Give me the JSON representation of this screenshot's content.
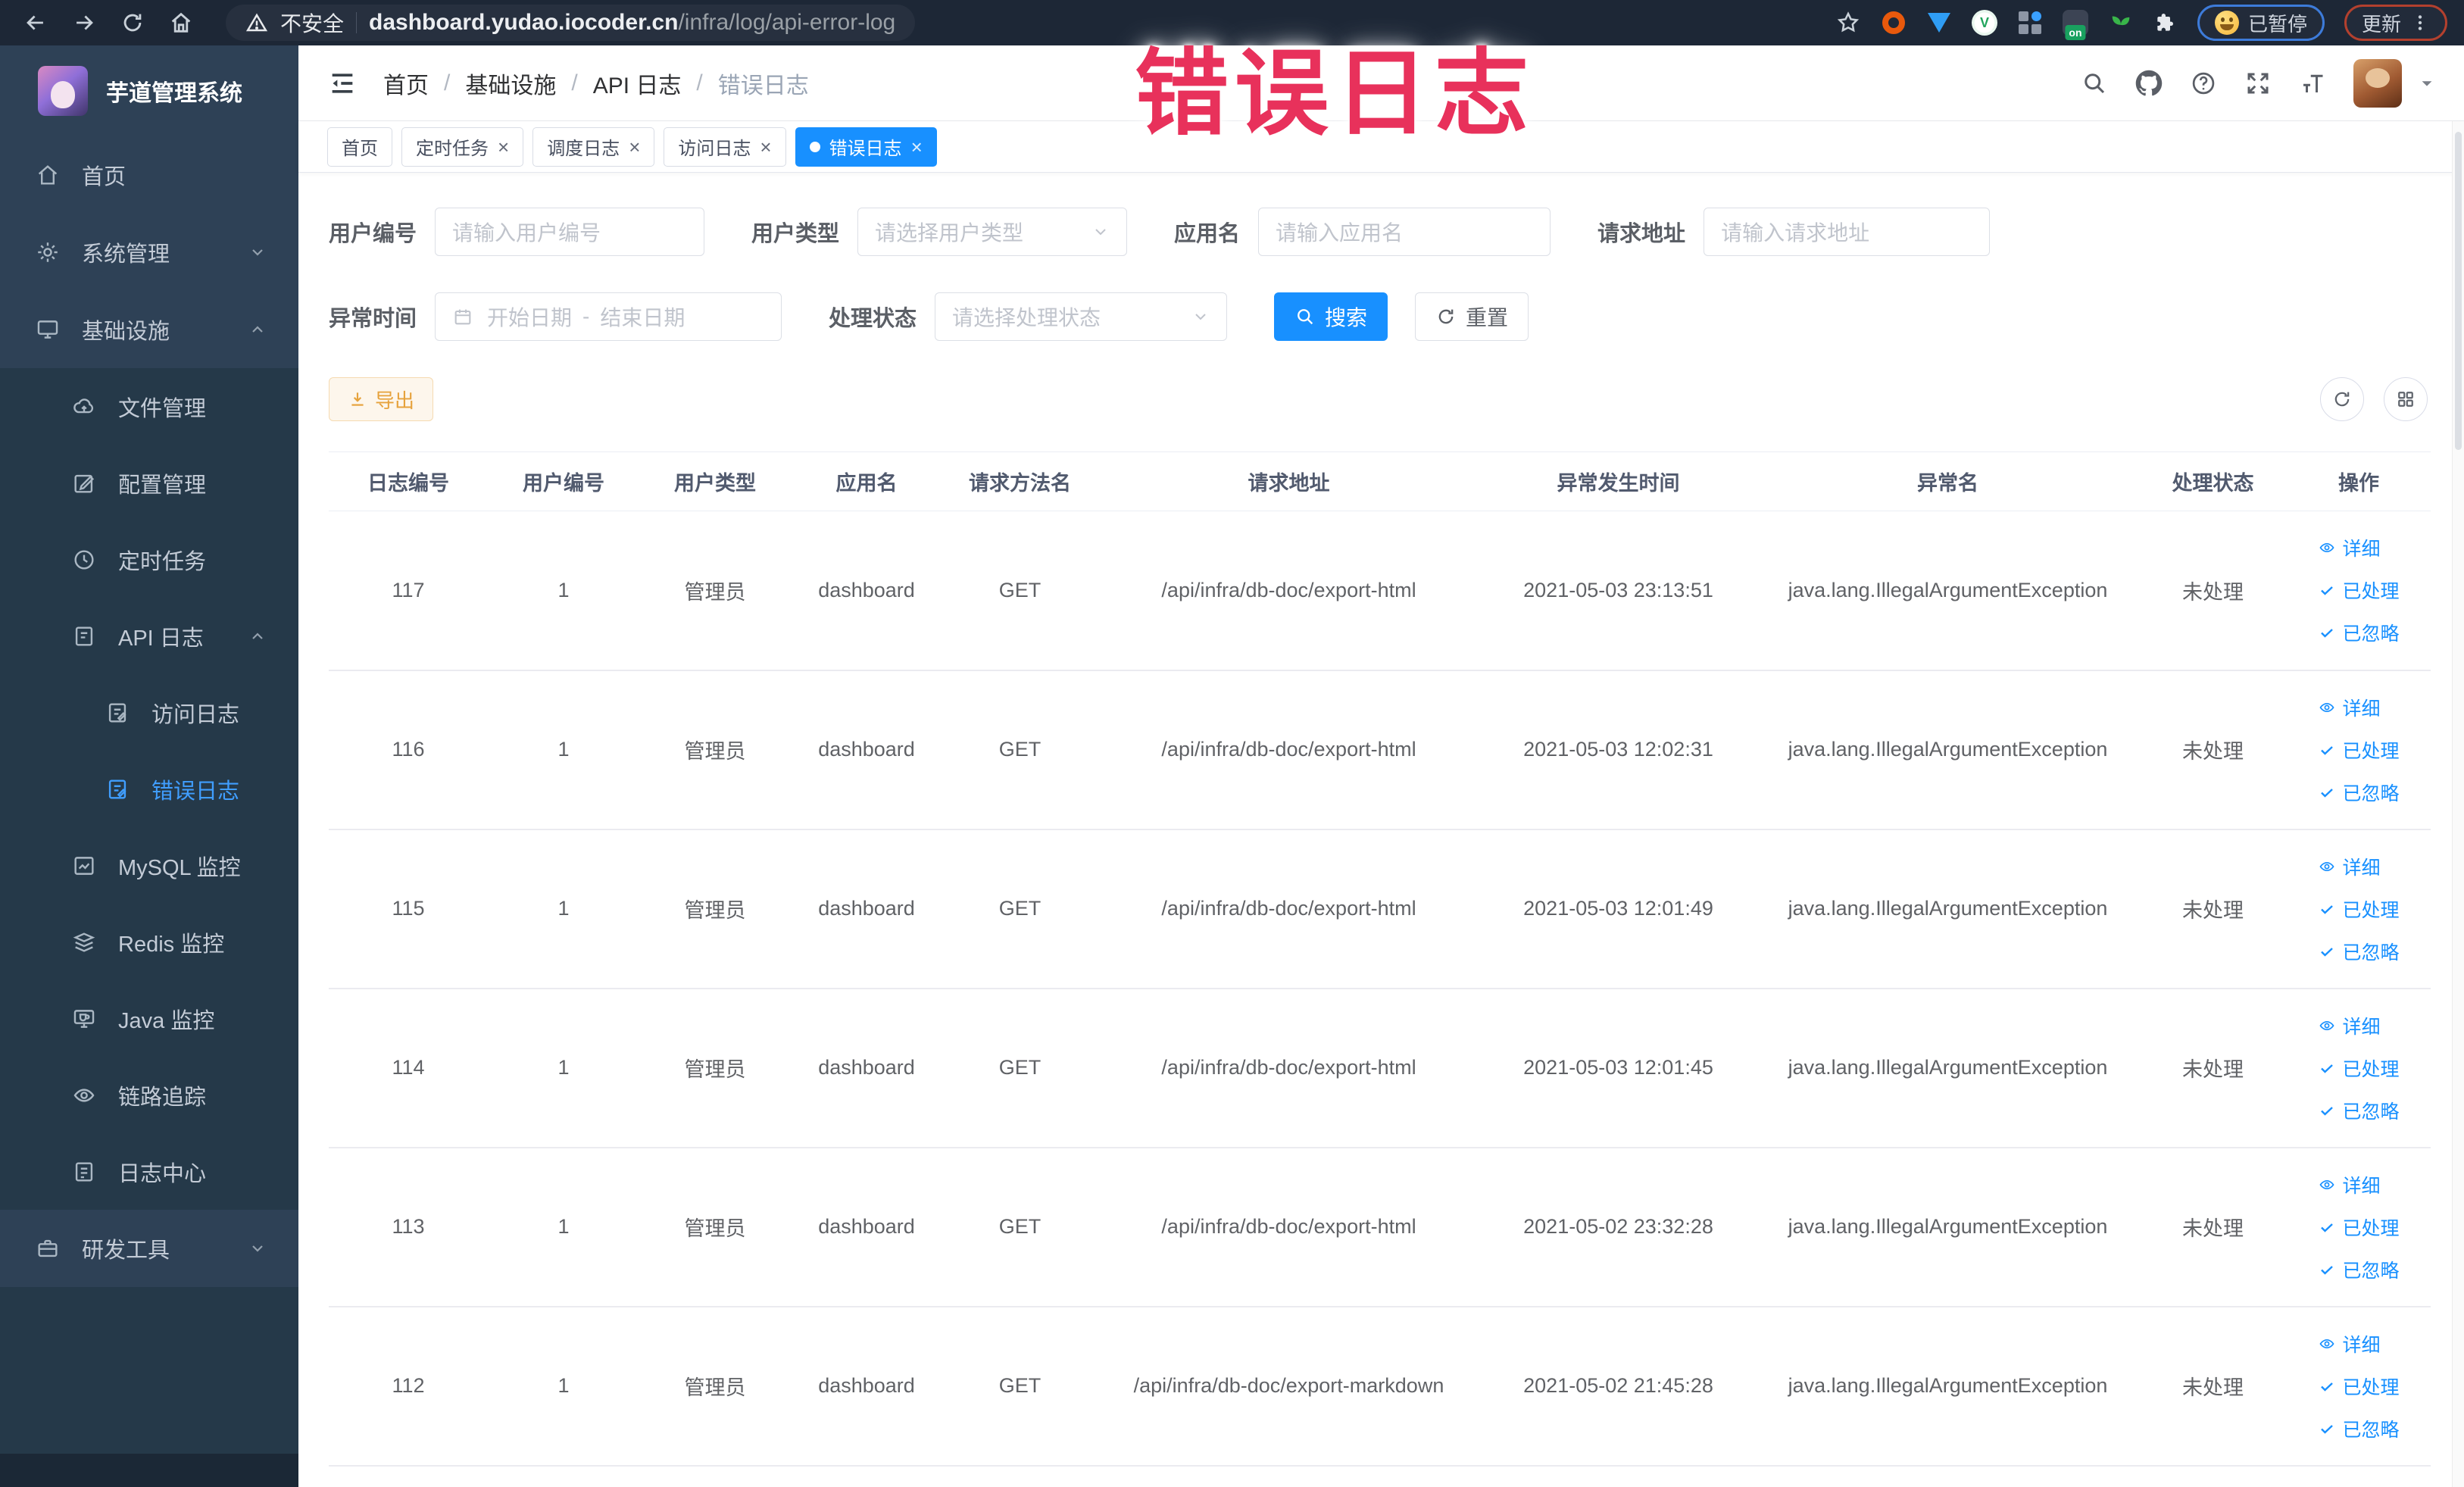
{
  "colors": {
    "accent": "#1890ff",
    "overlay": "#e8315b",
    "warning": "#e6a23c",
    "sidebar_active": "#409eff"
  },
  "overlay": {
    "title": "错误日志"
  },
  "browser": {
    "security_label": "不安全",
    "url_host": "dashboard.yudao.iocoder.cn",
    "url_path": "/infra/log/api-error-log",
    "paused_badge": "已暂停",
    "update_badge": "更新",
    "extension_on_badge": "on"
  },
  "sidebar": {
    "logo_title": "芋道管理系统",
    "items": [
      {
        "name": "home",
        "label": "首页",
        "icon": "home-icon",
        "type": "root"
      },
      {
        "name": "system-management",
        "label": "系统管理",
        "icon": "gear-icon",
        "type": "root",
        "chevron": "down"
      },
      {
        "name": "infrastructure",
        "label": "基础设施",
        "icon": "infrastructure-icon",
        "type": "root",
        "chevron": "up"
      },
      {
        "name": "file-management",
        "label": "文件管理",
        "icon": "file-manage-icon",
        "type": "sub"
      },
      {
        "name": "config-management",
        "label": "配置管理",
        "icon": "config-manage-icon",
        "type": "sub"
      },
      {
        "name": "scheduled-task",
        "label": "定时任务",
        "icon": "scheduled-task-icon",
        "type": "sub"
      },
      {
        "name": "api-log",
        "label": "API 日志",
        "icon": "api-log-icon",
        "type": "sub",
        "chevron": "up"
      },
      {
        "name": "access-log",
        "label": "访问日志",
        "icon": "access-log-icon",
        "type": "subsub"
      },
      {
        "name": "error-log",
        "label": "错误日志",
        "icon": "error-log-icon",
        "type": "subsub",
        "active": true
      },
      {
        "name": "mysql-monitor",
        "label": "MySQL 监控",
        "icon": "mysql-monitor-icon",
        "type": "sub"
      },
      {
        "name": "redis-monitor",
        "label": "Redis 监控",
        "icon": "redis-monitor-icon",
        "type": "sub"
      },
      {
        "name": "java-monitor",
        "label": "Java 监控",
        "icon": "java-monitor-icon",
        "type": "sub"
      },
      {
        "name": "trace",
        "label": "链路追踪",
        "icon": "trace-icon",
        "type": "sub"
      },
      {
        "name": "log-center",
        "label": "日志中心",
        "icon": "log-center-icon",
        "type": "sub"
      },
      {
        "name": "dev-tools",
        "label": "研发工具",
        "icon": "dev-tools-icon",
        "type": "root",
        "chevron": "down"
      }
    ]
  },
  "breadcrumb": [
    "首页",
    "基础设施",
    "API 日志",
    "错误日志"
  ],
  "tabs": [
    {
      "label": "首页",
      "closable": false,
      "active": false
    },
    {
      "label": "定时任务",
      "closable": true,
      "active": false
    },
    {
      "label": "调度日志",
      "closable": true,
      "active": false
    },
    {
      "label": "访问日志",
      "closable": true,
      "active": false
    },
    {
      "label": "错误日志",
      "closable": true,
      "active": true
    }
  ],
  "filters": {
    "user_id": {
      "label": "用户编号",
      "placeholder": "请输入用户编号"
    },
    "user_type": {
      "label": "用户类型",
      "placeholder": "请选择用户类型"
    },
    "app_name": {
      "label": "应用名",
      "placeholder": "请输入应用名"
    },
    "request_url": {
      "label": "请求地址",
      "placeholder": "请输入请求地址"
    },
    "exception_time": {
      "label": "异常时间",
      "start_placeholder": "开始日期",
      "separator": "-",
      "end_placeholder": "结束日期"
    },
    "process_status": {
      "label": "处理状态",
      "placeholder": "请选择处理状态"
    },
    "search_label": "搜索",
    "reset_label": "重置"
  },
  "toolbar": {
    "export_label": "导出"
  },
  "table": {
    "columns": [
      "日志编号",
      "用户编号",
      "用户类型",
      "应用名",
      "请求方法名",
      "请求地址",
      "异常发生时间",
      "异常名",
      "处理状态",
      "操作"
    ],
    "actions": {
      "detail": "详细",
      "processed": "已处理",
      "ignored": "已忽略"
    },
    "rows": [
      {
        "id": "117",
        "user_id": "1",
        "user_type": "管理员",
        "app": "dashboard",
        "method": "GET",
        "url": "/api/infra/db-doc/export-html",
        "time": "2021-05-03 23:13:51",
        "exception": "java.lang.IllegalArgumentException",
        "status": "未处理"
      },
      {
        "id": "116",
        "user_id": "1",
        "user_type": "管理员",
        "app": "dashboard",
        "method": "GET",
        "url": "/api/infra/db-doc/export-html",
        "time": "2021-05-03 12:02:31",
        "exception": "java.lang.IllegalArgumentException",
        "status": "未处理"
      },
      {
        "id": "115",
        "user_id": "1",
        "user_type": "管理员",
        "app": "dashboard",
        "method": "GET",
        "url": "/api/infra/db-doc/export-html",
        "time": "2021-05-03 12:01:49",
        "exception": "java.lang.IllegalArgumentException",
        "status": "未处理"
      },
      {
        "id": "114",
        "user_id": "1",
        "user_type": "管理员",
        "app": "dashboard",
        "method": "GET",
        "url": "/api/infra/db-doc/export-html",
        "time": "2021-05-03 12:01:45",
        "exception": "java.lang.IllegalArgumentException",
        "status": "未处理"
      },
      {
        "id": "113",
        "user_id": "1",
        "user_type": "管理员",
        "app": "dashboard",
        "method": "GET",
        "url": "/api/infra/db-doc/export-html",
        "time": "2021-05-02 23:32:28",
        "exception": "java.lang.IllegalArgumentException",
        "status": "未处理"
      },
      {
        "id": "112",
        "user_id": "1",
        "user_type": "管理员",
        "app": "dashboard",
        "method": "GET",
        "url": "/api/infra/db-doc/export-markdown",
        "time": "2021-05-02 21:45:28",
        "exception": "java.lang.IllegalArgumentException",
        "status": "未处理"
      }
    ]
  }
}
